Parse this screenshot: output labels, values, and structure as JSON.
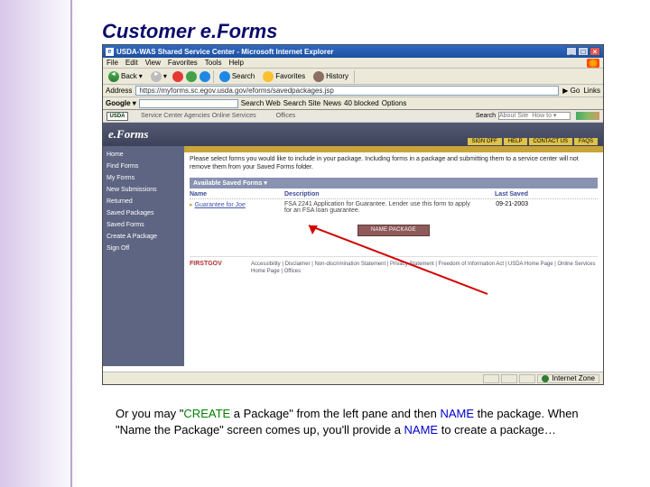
{
  "slide": {
    "title": "Customer e.Forms"
  },
  "window": {
    "title": "USDA-WAS Shared Service Center - Microsoft Internet Explorer",
    "ie_letter": "e"
  },
  "menubar": {
    "file": "File",
    "edit": "Edit",
    "view": "View",
    "favorites": "Favorites",
    "tools": "Tools",
    "help": "Help"
  },
  "toolbar": {
    "back": "Back",
    "search": "Search",
    "favorites": "Favorites",
    "history": "History"
  },
  "address": {
    "label": "Address",
    "url": "https://myforms.sc.egov.usda.gov/eforms/savedpackages.jsp",
    "go": "Go",
    "links": "Links"
  },
  "googlebar": {
    "logo": "Google ▾",
    "search_web": "Search Web",
    "search_site": "Search Site",
    "news": "News",
    "blocked": "40 blocked",
    "options": "Options"
  },
  "usda": {
    "logo": "USDA",
    "tab1": "Service Center Agencies Online Services",
    "tab2": "Offices",
    "search_label": "Search",
    "about": "About Site  How to ▾"
  },
  "eforms": {
    "logo": "e.Forms",
    "hdr_links": {
      "signoff": "SIGN OFF",
      "help": "HELP",
      "contact": "CONTACT US",
      "faqs": "FAQS"
    }
  },
  "leftnav": {
    "items": [
      "Home",
      "Find Forms",
      "My Forms",
      "New Submissions",
      "Returned",
      "Saved Packages",
      "Saved Forms",
      "Create A Package",
      "Sign Off"
    ]
  },
  "main": {
    "intro": "Please select forms you would like to include in your package. Including forms in a package and submitting them to a service center will not remove them from your Saved Forms folder.",
    "avail_header": "Available Saved Forms ▾",
    "columns": {
      "name": "Name",
      "desc": "Description",
      "date": "Last Saved"
    },
    "row": {
      "name": "Guarantee for Joe",
      "desc": "FSA 2241 Application for Guarantee. Lender use this form to apply for an FSA loan guarantee.",
      "date": "09-21-2003"
    },
    "button": "NAME PACKAGE"
  },
  "footer": {
    "firstgov": "FIRSTGOV",
    "links": "Accessibility | Disclaimer | Non-discrimination Statement | Privacy Statement | Freedom of Information Act | USDA Home Page | Online Services Home Page | Offices"
  },
  "status": {
    "zone": "Internet Zone"
  },
  "caption": {
    "p1a": "Or you may \"",
    "p1b": "CREATE",
    "p1c": " a Package\" from the left pane and then ",
    "p1d": "NAME",
    "p2a": " the package.  When \"Name the Package\" screen comes up, you'll provide a ",
    "p2b": "NAME",
    "p2c": " to create a package…"
  }
}
